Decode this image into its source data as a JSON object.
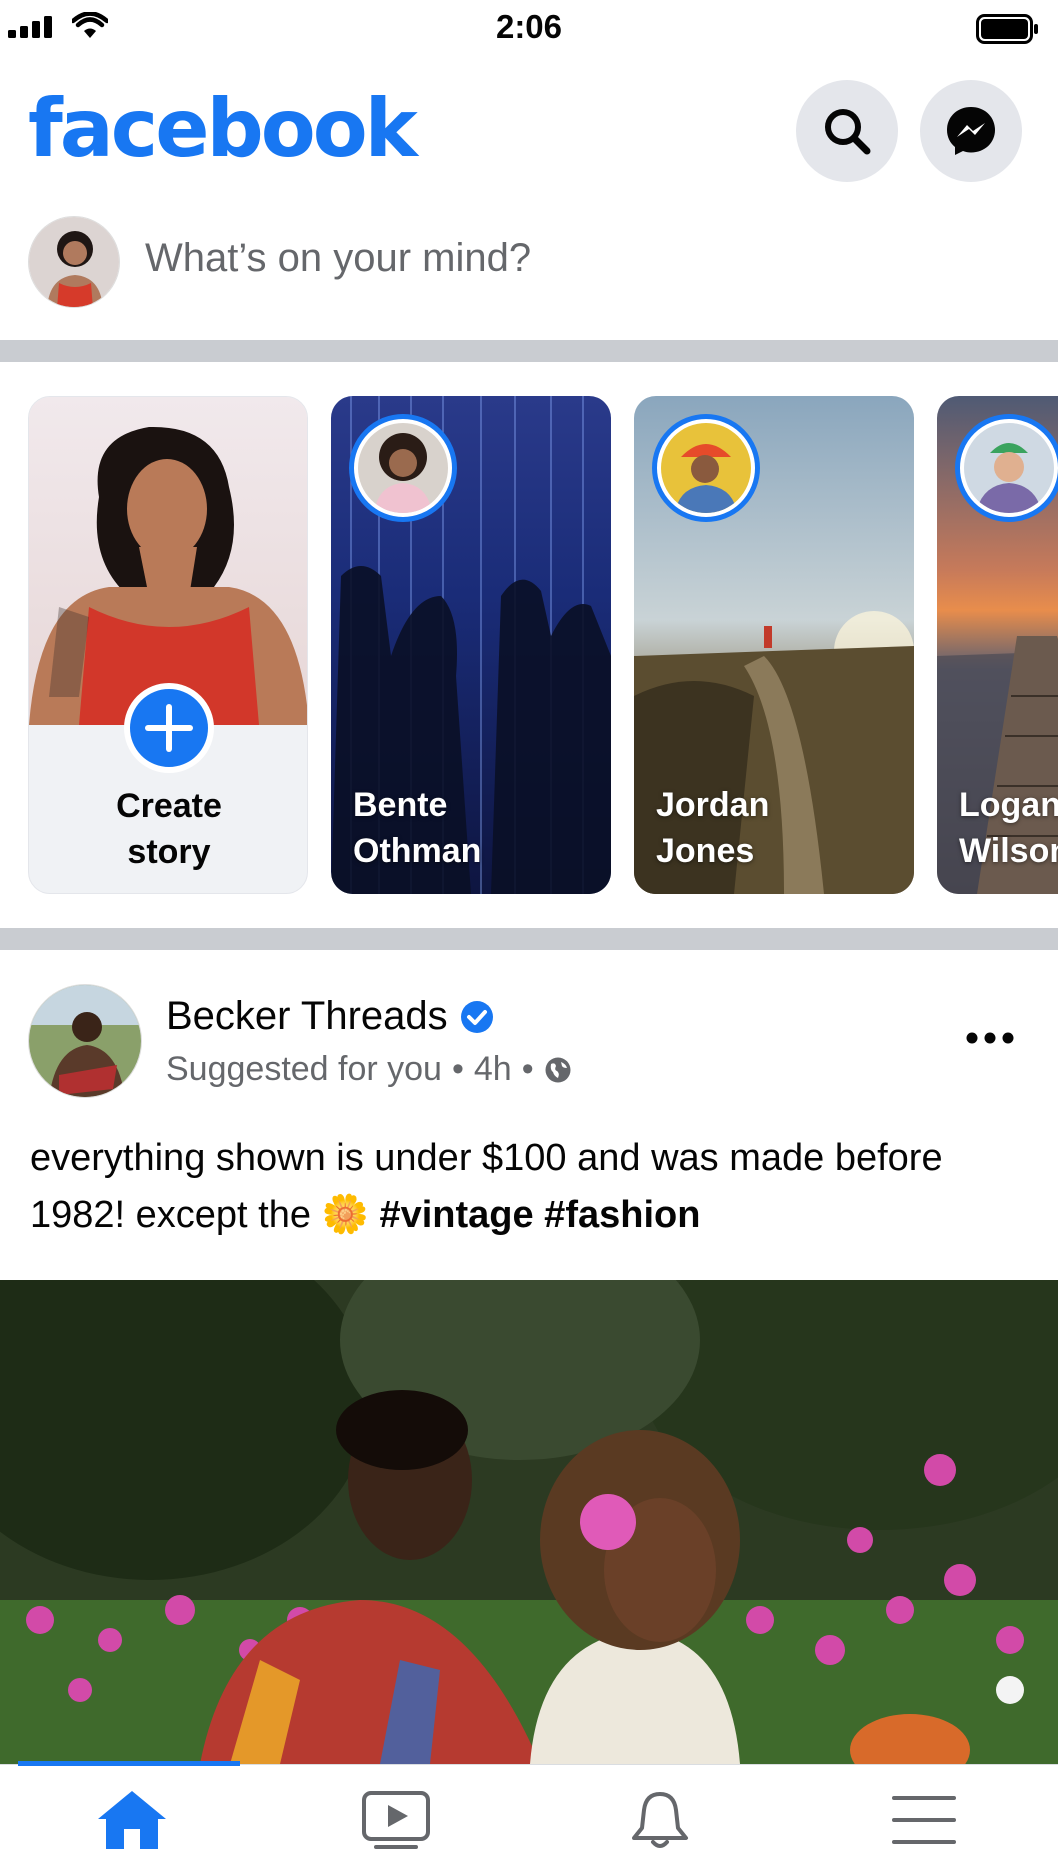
{
  "status_bar": {
    "time": "2:06"
  },
  "header": {
    "logo": "facebook",
    "search_icon": "search-icon",
    "messenger_icon": "messenger-icon"
  },
  "composer": {
    "placeholder": "What’s on your mind?"
  },
  "stories": {
    "create": {
      "line1": "Create",
      "line2": "story"
    },
    "items": [
      {
        "line1": "Bente",
        "line2": "Othman"
      },
      {
        "line1": "Jordan",
        "line2": "Jones"
      },
      {
        "line1": "Logan",
        "line2": "Wilson"
      }
    ]
  },
  "post": {
    "author": "Becker Threads",
    "verified": true,
    "meta": "Suggested for you",
    "time": "4h",
    "privacy_icon": "globe-icon",
    "text_plain": "everything shown is under $100 and was made before 1982! except the",
    "emoji": "🌼",
    "tags": "#vintage #fashion"
  },
  "tabbar": {
    "tabs": [
      {
        "name": "home",
        "icon": "home-icon",
        "active": true
      },
      {
        "name": "watch",
        "icon": "video-icon",
        "active": false
      },
      {
        "name": "notifications",
        "icon": "bell-icon",
        "active": false
      },
      {
        "name": "menu",
        "icon": "menu-icon",
        "active": false
      }
    ]
  },
  "colors": {
    "brand": "#1877f2",
    "divider": "#c9ccd1",
    "secondary_text": "#65676b"
  }
}
